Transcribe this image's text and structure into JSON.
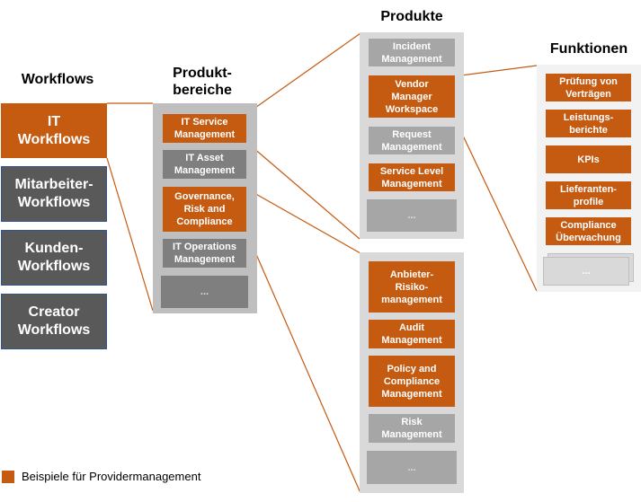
{
  "columns": {
    "workflows": {
      "heading": "Workflows",
      "items": [
        {
          "label": "IT\nWorkflows",
          "highlight": true
        },
        {
          "label": "Mitarbeiter-\nWorkflows",
          "highlight": false
        },
        {
          "label": "Kunden-\nWorkflows",
          "highlight": false
        },
        {
          "label": "Creator\nWorkflows",
          "highlight": false
        }
      ]
    },
    "produktbereiche": {
      "heading": "Produkt-\nbereiche",
      "items": [
        {
          "label": "IT Service\nManagement",
          "highlight": true
        },
        {
          "label": "IT Asset\nManagement",
          "highlight": false
        },
        {
          "label": "Governance,\nRisk and\nCompliance",
          "highlight": true
        },
        {
          "label": "IT Operations\nManagement",
          "highlight": false
        },
        {
          "label": "...",
          "highlight": false
        }
      ]
    },
    "produkte": {
      "heading": "Produkte",
      "groups": [
        {
          "parent": "IT Service Management",
          "items": [
            {
              "label": "Incident\nManagement",
              "highlight": false
            },
            {
              "label": "Vendor\nManager\nWorkspace",
              "highlight": true
            },
            {
              "label": "Request\nManagement",
              "highlight": false
            },
            {
              "label": "Service Level\nManagement",
              "highlight": true
            },
            {
              "label": "...",
              "highlight": false
            }
          ]
        },
        {
          "parent": "Governance, Risk and Compliance",
          "items": [
            {
              "label": "Anbieter-\nRisiko-\nmanagement",
              "highlight": true
            },
            {
              "label": "Audit\nManagement",
              "highlight": true
            },
            {
              "label": "Policy and\nCompliance\nManagement",
              "highlight": true
            },
            {
              "label": "Risk\nManagement",
              "highlight": false
            },
            {
              "label": "...",
              "highlight": false
            }
          ]
        }
      ]
    },
    "funktionen": {
      "heading": "Funktionen",
      "parent": "Vendor Manager Workspace",
      "items": [
        {
          "label": "Prüfung von\nVerträgen",
          "highlight": true
        },
        {
          "label": "Leistungs-\nberichte",
          "highlight": true
        },
        {
          "label": "KPIs",
          "highlight": true
        },
        {
          "label": "Lieferanten-\nprofile",
          "highlight": true
        },
        {
          "label": "Compliance\nÜberwachung",
          "highlight": true
        },
        {
          "label": "...",
          "highlight": false
        }
      ]
    }
  },
  "legend": {
    "label": "Beispiele für Providermanagement",
    "color": "#C55A11"
  },
  "colors": {
    "accent": "#C55A11",
    "workflow_dark": "#595959",
    "bereich_gray": "#7F7F7F",
    "produkt_gray": "#A6A6A6"
  }
}
